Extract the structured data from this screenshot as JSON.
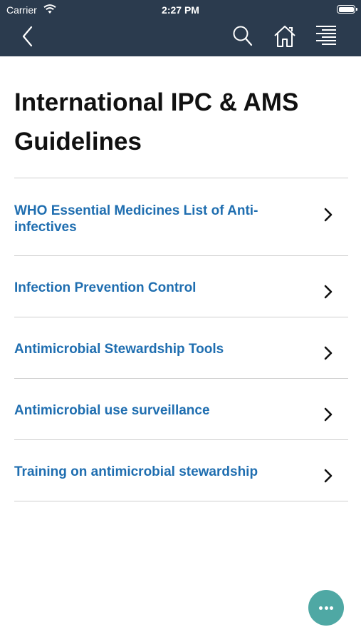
{
  "status_bar": {
    "carrier": "Carrier",
    "time": "2:27 PM"
  },
  "nav": {
    "icons": [
      "chevron-left-icon",
      "search-icon",
      "home-icon",
      "menu-icon"
    ]
  },
  "page": {
    "title": "International IPC & AMS Guidelines"
  },
  "list": {
    "items": [
      {
        "label": "WHO Essential Medicines List of Anti-infectives"
      },
      {
        "label": "Infection Prevention Control"
      },
      {
        "label": "Antimicrobial Stewardship Tools"
      },
      {
        "label": "Antimicrobial use surveillance"
      },
      {
        "label": "Training on antimicrobial stewardship"
      }
    ]
  },
  "fab": {
    "icon": "more-icon"
  },
  "colors": {
    "nav_bg": "#2b3b4e",
    "link": "#1f6eb0",
    "fab": "#4fa8a4"
  }
}
